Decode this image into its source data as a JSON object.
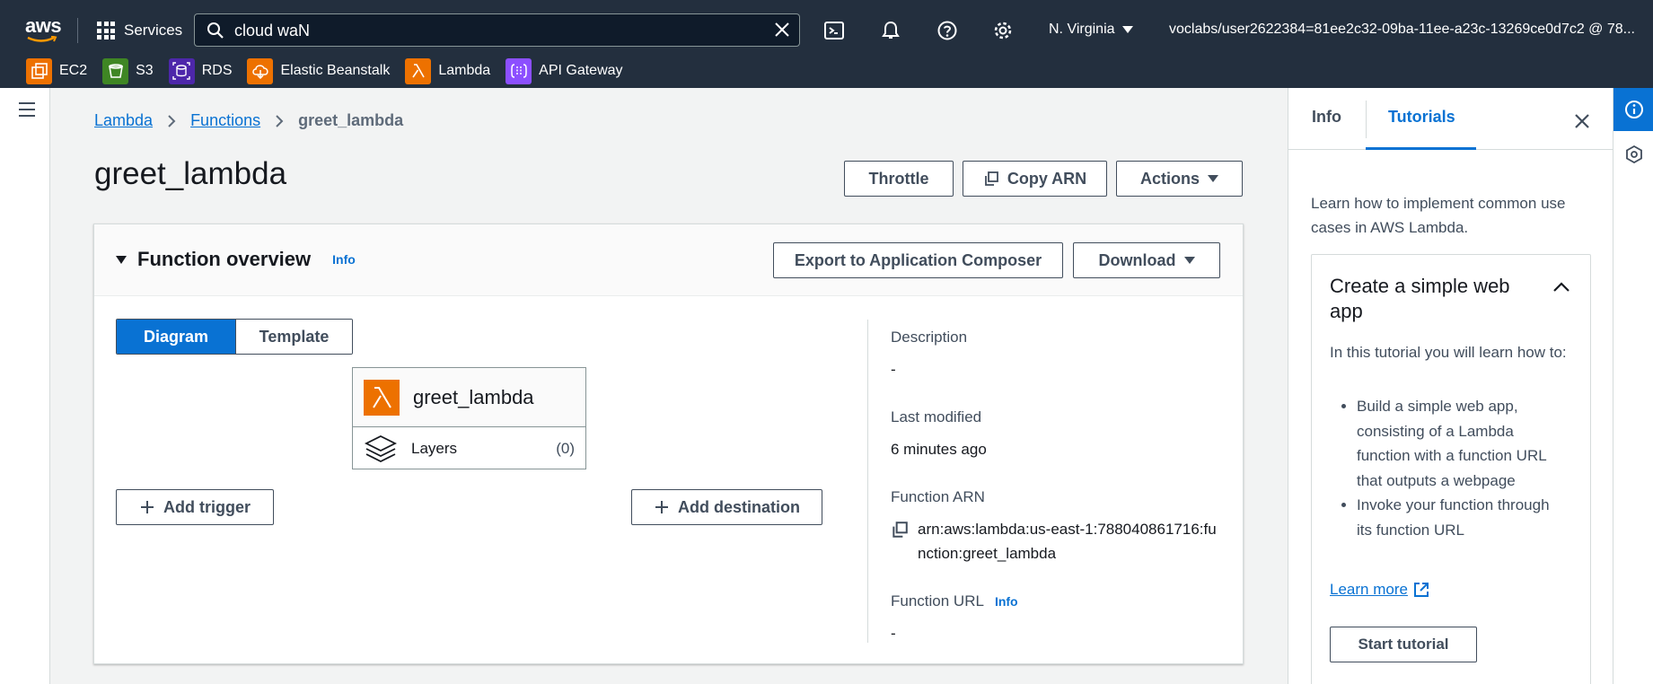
{
  "topnav": {
    "logo": "aws",
    "services_label": "Services",
    "search_value": "cloud waN",
    "region": "N. Virginia",
    "account": "voclabs/user2622384=81ee2c32-09ba-11ee-a23c-13269ce0d7c2 @ 78..."
  },
  "favorites": [
    {
      "label": "EC2",
      "color": "#ed7100"
    },
    {
      "label": "S3",
      "color": "#3f8624"
    },
    {
      "label": "RDS",
      "color": "#4d27aa"
    },
    {
      "label": "Elastic Beanstalk",
      "color": "#ed7100"
    },
    {
      "label": "Lambda",
      "color": "#ed7100"
    },
    {
      "label": "API Gateway",
      "color": "#8c4fff"
    }
  ],
  "breadcrumb": {
    "lambda": "Lambda",
    "functions": "Functions",
    "current": "greet_lambda"
  },
  "page": {
    "title": "greet_lambda",
    "throttle": "Throttle",
    "copy_arn": "Copy ARN",
    "actions": "Actions"
  },
  "overview": {
    "title": "Function overview",
    "info": "Info",
    "export": "Export to Application Composer",
    "download": "Download",
    "tab_diagram": "Diagram",
    "tab_template": "Template",
    "function_name": "greet_lambda",
    "layers_label": "Layers",
    "layers_count": "(0)",
    "add_trigger": "Add trigger",
    "add_destination": "Add destination",
    "description_label": "Description",
    "description_value": "-",
    "last_modified_label": "Last modified",
    "last_modified_value": "6 minutes ago",
    "arn_label": "Function ARN",
    "arn_value": "arn:aws:lambda:us-east-1:788040861716:function:greet_lambda",
    "url_label": "Function URL",
    "url_info": "Info",
    "url_value": "-"
  },
  "help": {
    "tab_info": "Info",
    "tab_tutorials": "Tutorials",
    "intro": "Learn how to implement common use cases in AWS Lambda.",
    "card_title": "Create a simple web app",
    "card_desc": "In this tutorial you will learn how to:",
    "bullets": [
      "Build a simple web app, consisting of a Lambda function with a function URL that outputs a webpage",
      "Invoke your function through its function URL"
    ],
    "learn_more": "Learn more",
    "start": "Start tutorial"
  },
  "colors": {
    "nav": "#232f3e",
    "accent": "#0972d3",
    "lambda_orange": "#ed7100"
  }
}
